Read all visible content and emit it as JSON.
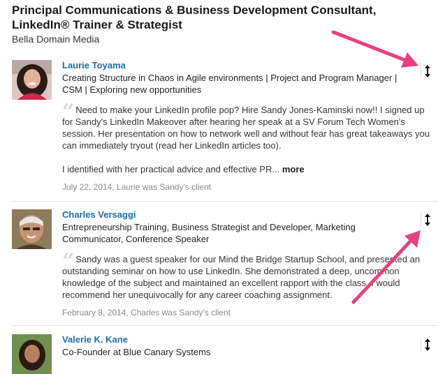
{
  "position": {
    "title_line1": "Principal Communications & Business Development Consultant,",
    "title_line2": "LinkedIn® Trainer & Strategist",
    "company": "Bella Domain Media"
  },
  "recommendations": [
    {
      "name": "Laurie Toyama",
      "headline_line1": "Creating Structure in Chaos in Agile environments | Project and Program Manager |",
      "headline_line2": "CSM | Exploring new opportunities",
      "text_line1": "Need to make your LinkedIn profile pop? Hire Sandy Jones-Kaminski now!! I signed up",
      "text_line2": "for Sandy's LinkedIn Makeover after hearing her speak at a SV Forum Tech Women's",
      "text_line3": "session. Her presentation on how to network well and without fear has great takeaways you",
      "text_line4": "can immediately tryout (read her LinkedIn articles too).",
      "text_line5": "I identified with her practical advice and effective PR...",
      "more_label": "more",
      "meta": "July 22, 2014, Laurie was Sandy's client"
    },
    {
      "name": "Charles Versaggi",
      "headline_line1": "Entrepreneurship Training, Business Strategist and Developer, Marketing",
      "headline_line2": "Communicator, Conference Speaker",
      "text_line1": "Sandy was a guest speaker for our Mind the Bridge Startup School, and presented an",
      "text_line2": "outstanding seminar on how to use LinkedIn. She demonstrated a deep, uncommon",
      "text_line3": "knowledge of the subject and maintained an excellent rapport with the class. I would",
      "text_line4": "recommend her unequivocally for any career coaching assignment.",
      "meta": "February 8, 2014, Charles was Sandy's client"
    },
    {
      "name": "Valerie K. Kane",
      "headline_line1": "Co-Founder at Blue Canary Systems"
    }
  ],
  "icons": {
    "reorder": "up-down-arrow-icon",
    "annotation": "pink-arrow-annotation"
  },
  "colors": {
    "name_link": "#1c6ca3",
    "annotation_arrow": "#e8407f",
    "meta_text": "#888888"
  }
}
